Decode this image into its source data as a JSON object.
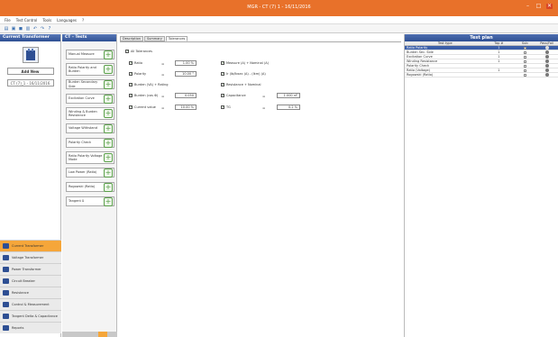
{
  "window": {
    "title": "MGR - CT (7) 1 - 16/11/2016",
    "controls": [
      "–",
      "□",
      "✕"
    ]
  },
  "menu": [
    "File",
    "Test Control",
    "Tools",
    "Languages",
    "?"
  ],
  "toolbar_icons": [
    "new-file-icon",
    "open-icon",
    "save-icon",
    "print-icon",
    "undo-icon",
    "redo-icon",
    "help-icon"
  ],
  "left_panel": {
    "title": "Current Transformer",
    "add_button": "Add New",
    "item": "CT (7)_1 - 16/11/2016",
    "nav": [
      {
        "label": "Current Transformer",
        "active": true
      },
      {
        "label": "Voltage Transformer",
        "active": false
      },
      {
        "label": "Power Transformer",
        "active": false
      },
      {
        "label": "Circuit Breaker",
        "active": false
      },
      {
        "label": "Resistance",
        "active": false
      },
      {
        "label": "Control & Measurement",
        "active": false
      },
      {
        "label": "Tangent Delta & Capacitance",
        "active": false
      },
      {
        "label": "Reports",
        "active": false
      }
    ]
  },
  "test_list": {
    "title": "CT - Tests",
    "items": [
      "Manual Measure",
      "Ratio Polarity and Burden",
      "Burden Secondary Side",
      "Excitation Curve",
      "Winding & Burden Resistance",
      "Voltage Withstand",
      "Polarity Check",
      "Ratio Polarity Voltage Mode",
      "Low Power (Ratio)",
      "Rogowski (Ratio)",
      "Tangent δ"
    ]
  },
  "main": {
    "tabs": [
      "Description",
      "Summary",
      "Tolerances"
    ],
    "active_tab": 2,
    "settings": {
      "all_tolerances": "All Tolerances",
      "ratio_label": "Ratio",
      "ratio_value": "1.00 %",
      "polarity_label": "Polarity",
      "polarity_value": "10.00 °",
      "burden_label": "Burden (VA) + Rating",
      "burden_cos_label": "Burden (cos Φ)",
      "burden_cos_value": "0.050",
      "current_value_label": "Current value",
      "current_value": "10.00 %",
      "measure_label": "Measure (A) + Nominal (A)",
      "secondary_label": "Ir (Ib/Ibsec (A) - (Ikm) (A)",
      "resistance_label": "Resistance + Nominal",
      "capacitance_label": "Capacitance",
      "capacitance_value": "1.000 nF",
      "tg_label": "TG",
      "tg_value": "0.2 %"
    }
  },
  "test_plan": {
    "title": "Test plan",
    "columns": [
      "Test type",
      "Tap #",
      "Sub",
      "Pass/Fail"
    ],
    "rows": [
      {
        "name": "Ratio Polarity",
        "tap": "1",
        "sub": true,
        "selected": true
      },
      {
        "name": "Burden Sec. Side",
        "tap": "1",
        "sub": false,
        "selected": false
      },
      {
        "name": "Excitation Curve",
        "tap": "1",
        "sub": false,
        "selected": false
      },
      {
        "name": "Winding Resistance",
        "tap": "1",
        "sub": false,
        "selected": false
      },
      {
        "name": "Polarity Check",
        "tap": "",
        "sub": false,
        "selected": false
      },
      {
        "name": "Ratio (Voltage)",
        "tap": "1",
        "sub": false,
        "selected": false
      },
      {
        "name": "Rogowski (Ratio)",
        "tap": "",
        "sub": false,
        "selected": false
      }
    ]
  },
  "colors": {
    "titlebar": "#e8712a",
    "panel_header": "#2e4f93",
    "active_nav": "#f5a63a",
    "add_icon": "#5aa04a",
    "selected_row": "#3a5ea8"
  }
}
